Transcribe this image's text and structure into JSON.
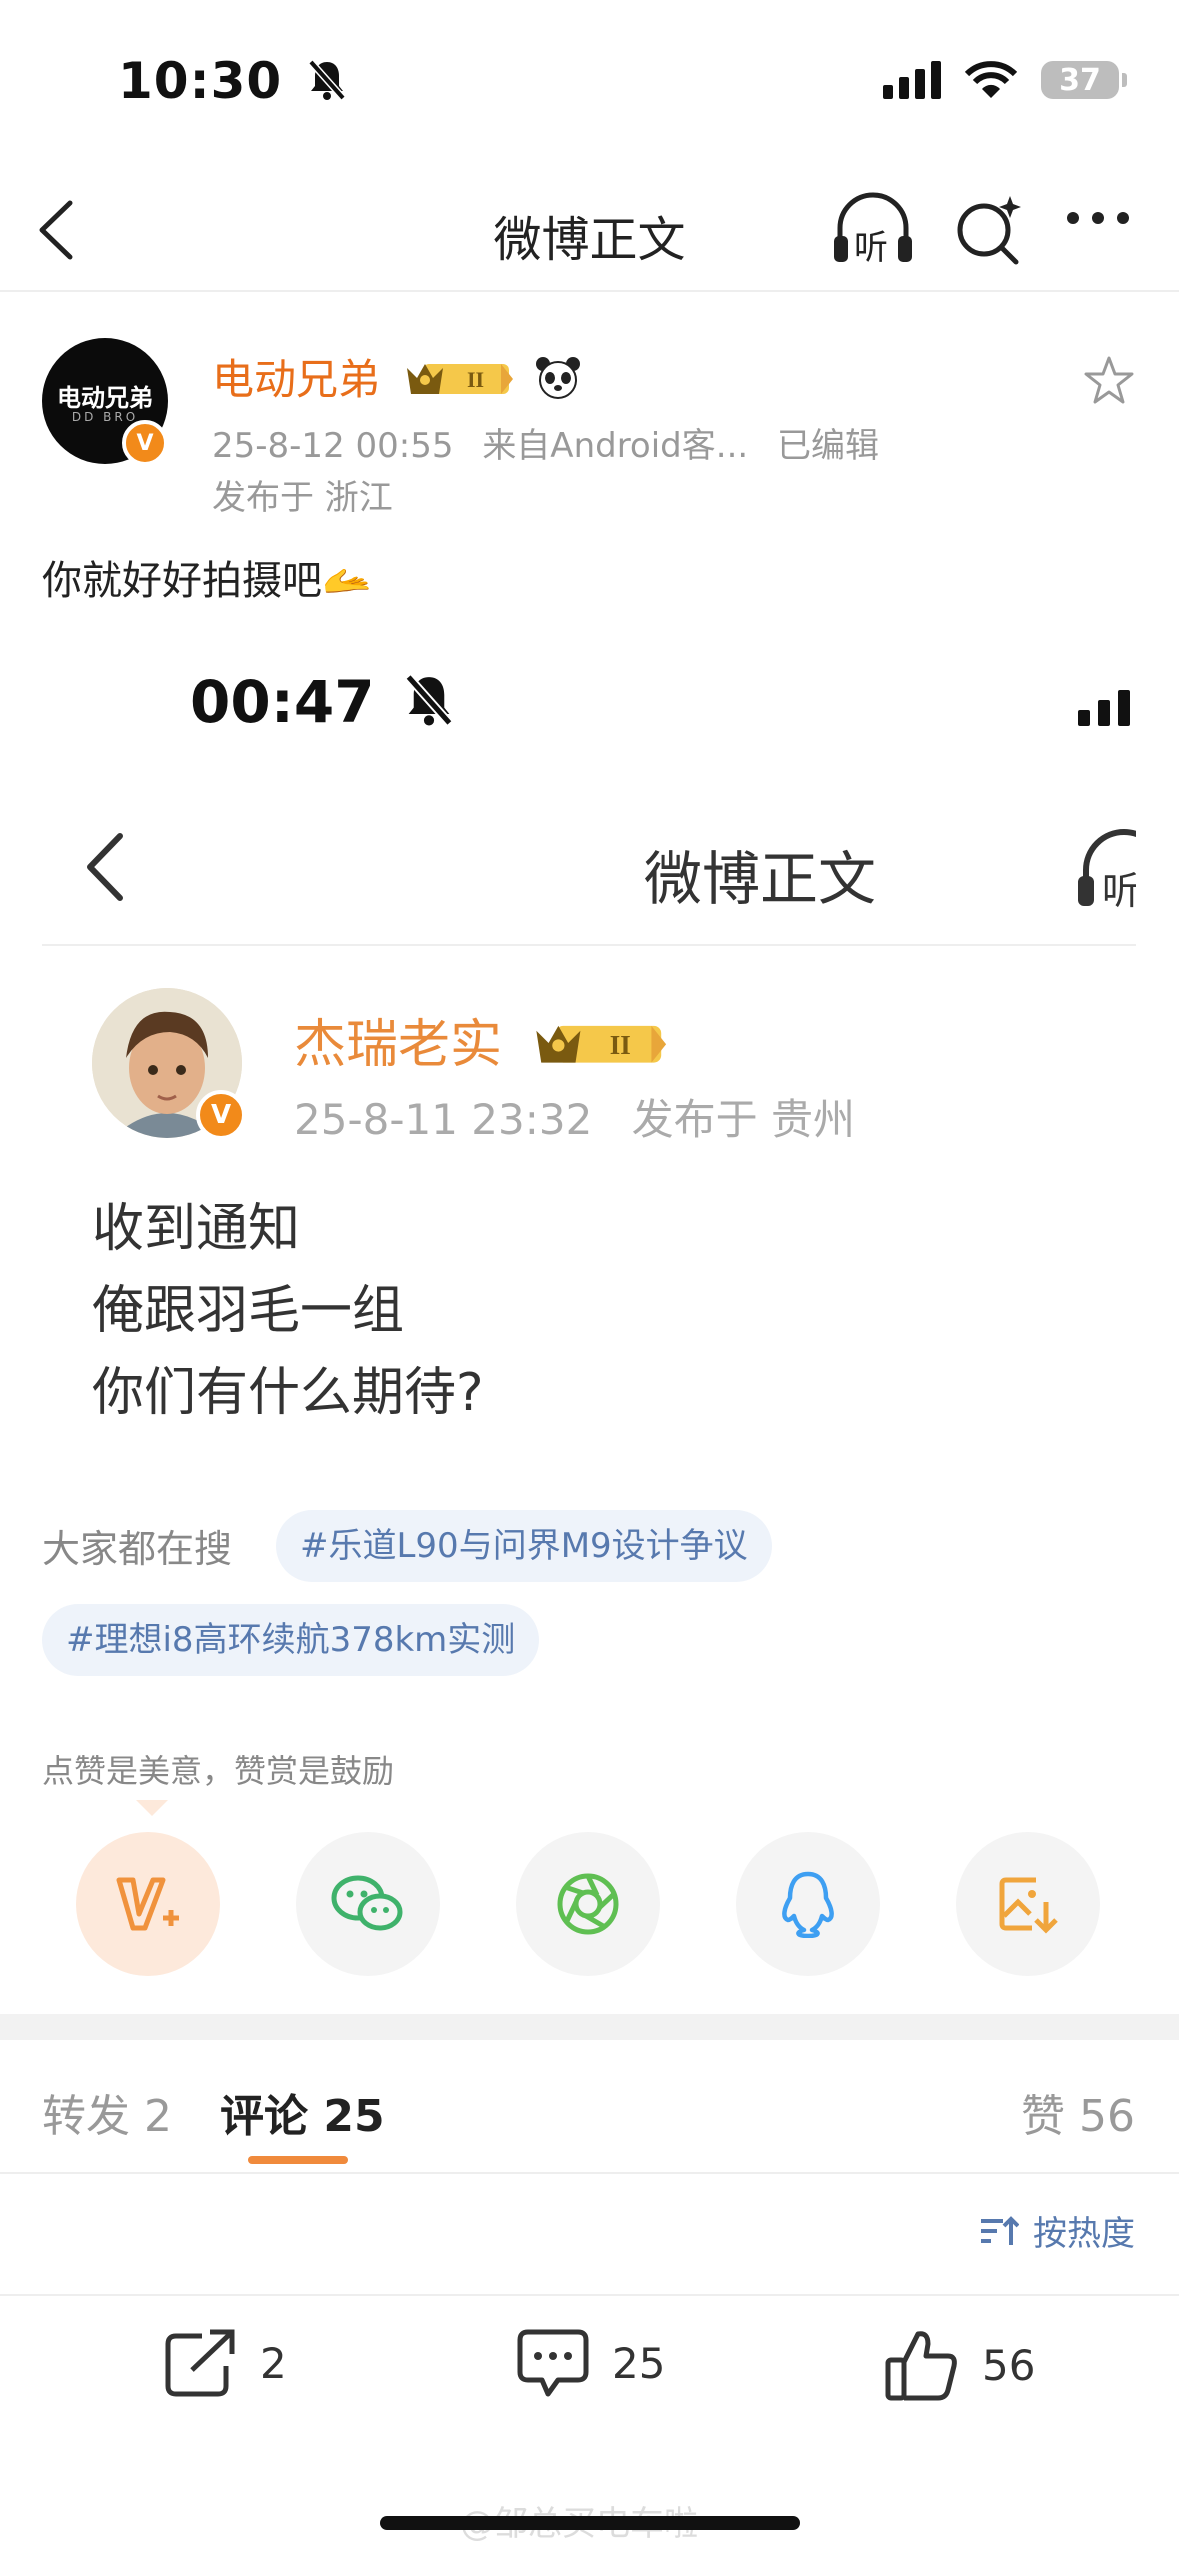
{
  "status_bar": {
    "time": "10:30",
    "battery": "37"
  },
  "nav": {
    "title": "微博正文",
    "listen_label": "听"
  },
  "post": {
    "author": "电动兄弟",
    "avatar_text": "电动兄弟",
    "avatar_subtext": "DD BRO",
    "timestamp": "25-8-12 00:55",
    "source": "来自Android客...",
    "edited": "已编辑",
    "location": "发布于 浙江",
    "text": "你就好好拍摄吧🫴"
  },
  "embedded_screenshot": {
    "time": "00:47",
    "title": "微博正文",
    "listen_label": "听",
    "author": "杰瑞老实",
    "timestamp": "25-8-11 23:32",
    "location": "发布于 贵州",
    "lines": [
      "收到通知",
      "俺跟羽毛一组",
      "你们有什么期待?"
    ]
  },
  "trending": {
    "label": "大家都在搜",
    "topics": [
      "#乐道L90与问界M9设计争议",
      "#理想i8高环续航378km实测"
    ]
  },
  "praise_text": "点赞是美意，赞赏是鼓励",
  "share_targets": [
    "reward",
    "wechat",
    "moments",
    "qq",
    "save-image"
  ],
  "tabs": {
    "repost": {
      "label": "转发",
      "count": "2"
    },
    "comment": {
      "label": "评论",
      "count": "25"
    },
    "like": {
      "label": "赞",
      "count": "56"
    }
  },
  "sort_label": "按热度",
  "actions": {
    "repost_count": "2",
    "comment_count": "25",
    "like_count": "56"
  },
  "watermark": "@邹总买电车啦",
  "colors": {
    "accent": "#e86e1a",
    "link": "#5779ae",
    "vip_badge": "#f28a1a"
  }
}
